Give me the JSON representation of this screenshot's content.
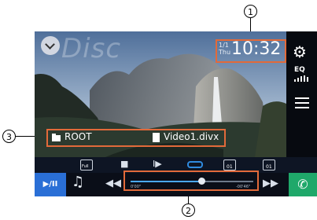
{
  "callouts": {
    "clock": "1",
    "seek": "2",
    "path": "3"
  },
  "overlay": {
    "disc_label": "Disc"
  },
  "clock": {
    "date_top": "1/1",
    "date_bottom": "Thu",
    "time": "10:32"
  },
  "side_panel": {
    "eq_label": "EQ"
  },
  "file_path": {
    "folder": "ROOT",
    "file": "Video1.divx"
  },
  "controls": {
    "play_pause_label": "▶/II",
    "short_labels": [
      "Full",
      "01",
      "01"
    ]
  },
  "seek": {
    "elapsed": "0'00\"",
    "remaining": "-00'46\"",
    "progress": 0.58
  },
  "colors": {
    "highlight": "#e26a3a",
    "accent_blue": "#2a6fd6",
    "phone_green": "#1fa86a"
  },
  "icons": [
    "back-chevron-icon",
    "gear-icon",
    "eq-icon",
    "list-icon",
    "folder-icon",
    "file-icon",
    "aspect-icon",
    "stop-icon",
    "slow-play-icon",
    "repeat-icon",
    "audio-track-icon",
    "subtitle-icon",
    "play-pause-icon",
    "music-source-icon",
    "rewind-icon",
    "fast-forward-icon",
    "phone-icon"
  ]
}
